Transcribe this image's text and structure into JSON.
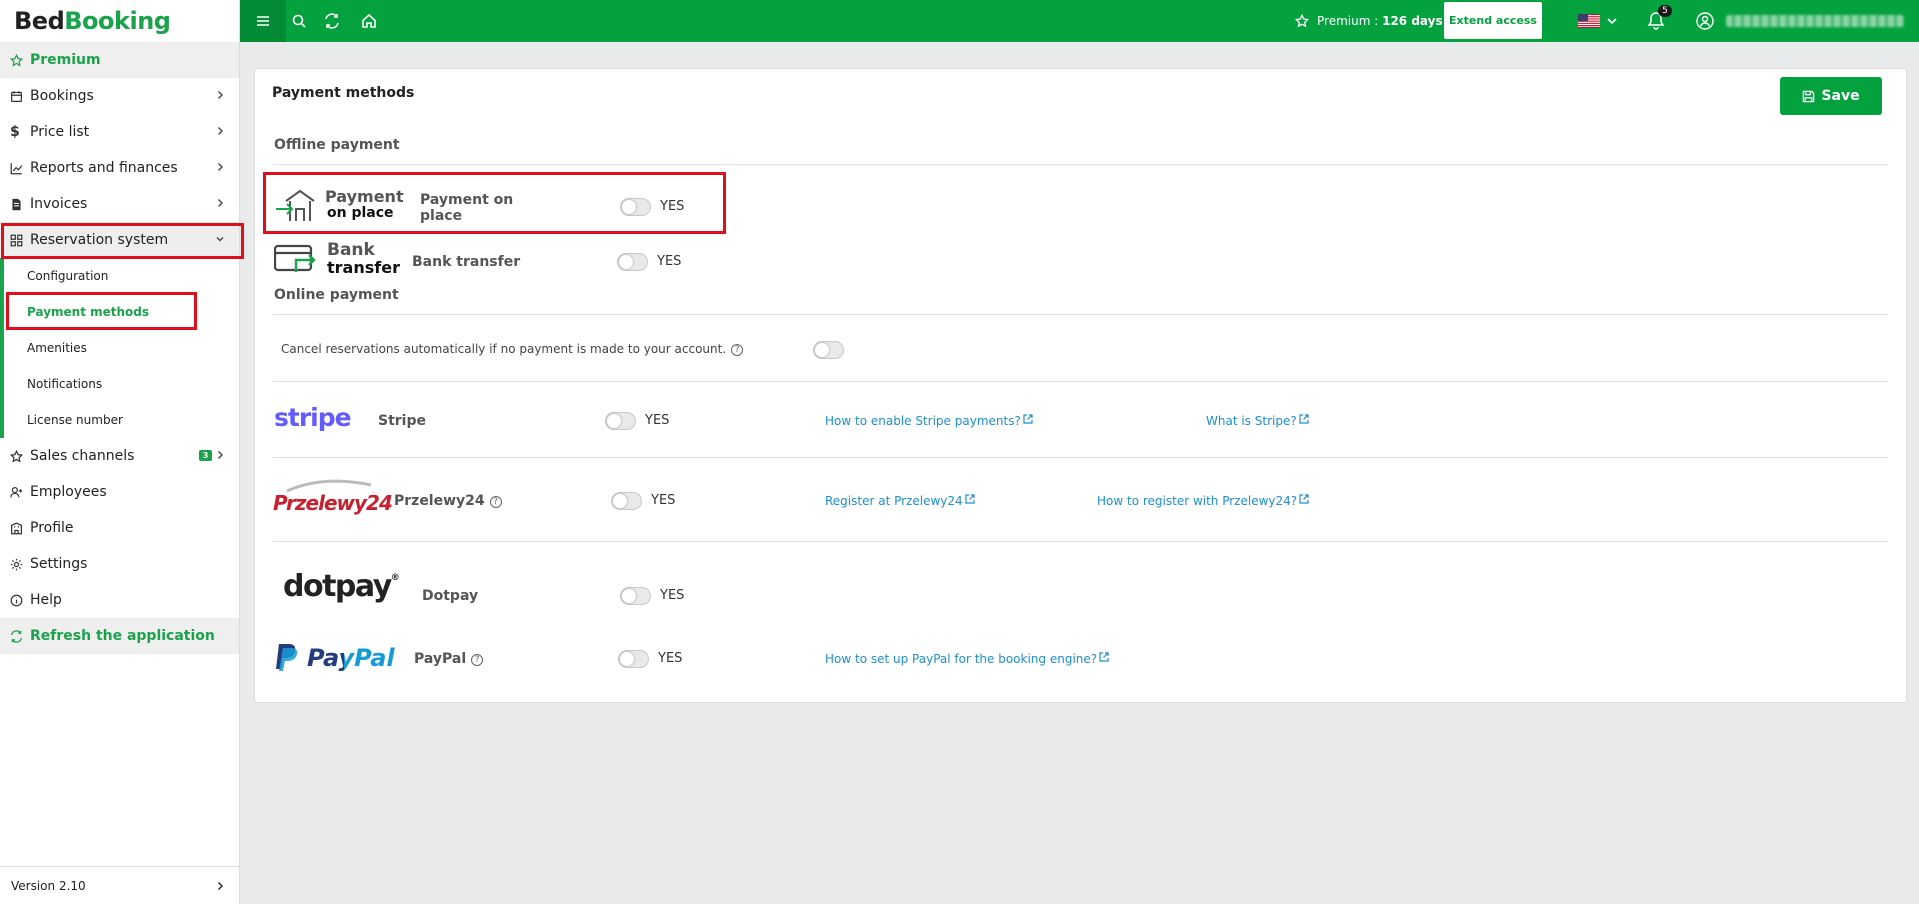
{
  "logo": {
    "part1": "Bed",
    "part2": "Booking"
  },
  "sidebar": {
    "premium": "Premium",
    "items": [
      {
        "label": "Bookings",
        "icon": "calendar-icon"
      },
      {
        "label": "Price list",
        "icon": "dollar-icon"
      },
      {
        "label": "Reports and finances",
        "icon": "chart-icon"
      },
      {
        "label": "Invoices",
        "icon": "invoice-icon"
      },
      {
        "label": "Reservation system",
        "icon": "grid-icon"
      }
    ],
    "sub_items": [
      "Configuration",
      "Payment methods",
      "Amenities",
      "Notifications",
      "License number"
    ],
    "items2": [
      {
        "label": "Sales channels",
        "icon": "star-icon",
        "badge": "3"
      },
      {
        "label": "Employees",
        "icon": "users-icon"
      },
      {
        "label": "Profile",
        "icon": "building-icon"
      },
      {
        "label": "Settings",
        "icon": "gear-icon"
      },
      {
        "label": "Help",
        "icon": "info-icon"
      }
    ],
    "refresh": "Refresh the application",
    "version": "Version 2.10"
  },
  "topbar": {
    "premium_label": "Premium : ",
    "premium_days": "126 days",
    "extend": "Extend access",
    "notifications_count": "5"
  },
  "page": {
    "title": "Payment methods",
    "save": "Save",
    "offline_title": "Offline payment",
    "online_title": "Online payment",
    "cancel_text": "Cancel reservations automatically if no payment is made to your account."
  },
  "logos": {
    "payment_on_place": {
      "line1": "Payment",
      "line2": "on place"
    },
    "bank_transfer": {
      "line1": "Bank",
      "line2": "transfer"
    },
    "stripe": "stripe",
    "przelewy": "Przelewy24",
    "dotpay": "dotpay",
    "paypal": "PayPal"
  },
  "methods": {
    "payment_on_place": {
      "name_line1": "Payment on",
      "name_line2": "place",
      "yes": "YES"
    },
    "bank_transfer": {
      "name": "Bank transfer",
      "yes": "YES"
    },
    "stripe": {
      "name": "Stripe",
      "yes": "YES",
      "link1": "How to enable Stripe payments?",
      "link2": "What is Stripe?"
    },
    "przelewy24": {
      "name": "Przelewy24",
      "yes": "YES",
      "link1": "Register at Przelewy24",
      "link2": "How to register with Przelewy24?"
    },
    "dotpay": {
      "name": "Dotpay",
      "yes": "YES"
    },
    "paypal": {
      "name": "PayPal",
      "yes": "YES",
      "link1": "How to set up PayPal for the booking engine?"
    }
  },
  "colors": {
    "brand_green": "#04a23e",
    "link_blue": "#1b8fd2",
    "highlight_red": "#e0101a"
  }
}
